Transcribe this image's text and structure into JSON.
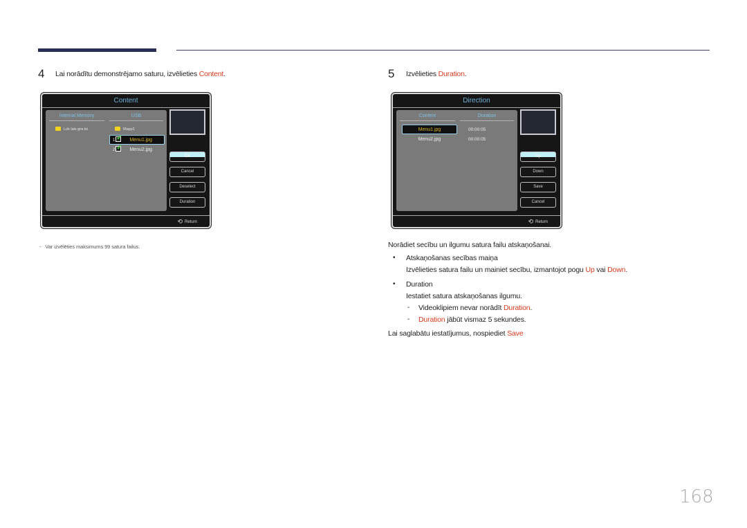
{
  "page_number": "168",
  "step4": {
    "number": "4",
    "text_before": "Lai norādītu demonstrējamo saturu, izvēlieties ",
    "highlight": "Content",
    "text_after": ".",
    "dialog": {
      "title": "Content",
      "columns": [
        "Internal Memory",
        "USB"
      ],
      "internal_items": [
        {
          "icon": "folder-icon",
          "label": "Lok lais gra ks"
        }
      ],
      "usb_folder": {
        "icon": "folder-icon",
        "label": "Mapp1"
      },
      "files": [
        {
          "index": "1",
          "checked": true,
          "label": "Menu1.jpg",
          "selected": true
        },
        {
          "index": "2",
          "checked": true,
          "label": "Menu2.jpg",
          "selected": false
        }
      ],
      "buttons": [
        "OK",
        "Cancel",
        "Deselect",
        "Duration"
      ],
      "selected_button": "OK",
      "return_label": "Return"
    },
    "note": "Var izvēlēties maksimums 99 satura failus."
  },
  "step5": {
    "number": "5",
    "text_before": "Izvēlieties ",
    "highlight": "Duration",
    "text_after": ".",
    "dialog": {
      "title": "Direction",
      "columns": [
        "Content",
        "Duration"
      ],
      "rows": [
        {
          "file": "Menu1.jpg",
          "duration": "00:00:05",
          "selected": true
        },
        {
          "file": "Menu2.jpg",
          "duration": "00:00:05",
          "selected": false
        }
      ],
      "buttons": [
        "Up",
        "Down",
        "Save",
        "Cancel"
      ],
      "selected_button": "Up",
      "return_label": "Return"
    },
    "intro": "Norādiet secību un ilgumu satura failu atskaņošanai.",
    "bullet1_title": "Atskaņošanas secības maiņa",
    "bullet1_text_before": "Izvēlieties satura failu un mainiet secību, izmantojot pogu ",
    "bullet1_up": "Up",
    "bullet1_mid": " vai ",
    "bullet1_down": "Down",
    "bullet1_after": ".",
    "bullet2_title": "Duration",
    "bullet2_text": "Iestatiet satura atskaņošanas ilgumu.",
    "sub1_before": "Videoklipiem nevar norādīt ",
    "sub1_highlight": "Duration",
    "sub1_after": ".",
    "sub2_highlight": "Duration",
    "sub2_after": " jābūt vismaz 5 sekundes.",
    "save_before": "Lai saglabātu iestatījumus, nospiediet ",
    "save_highlight": "Save",
    "bullet_glyph": "•",
    "dash_glyph": "-"
  },
  "colors": {
    "accent_red": "#d23a1f",
    "header_bar": "#2a2f55",
    "dialog_title": "#6fb0d8"
  }
}
